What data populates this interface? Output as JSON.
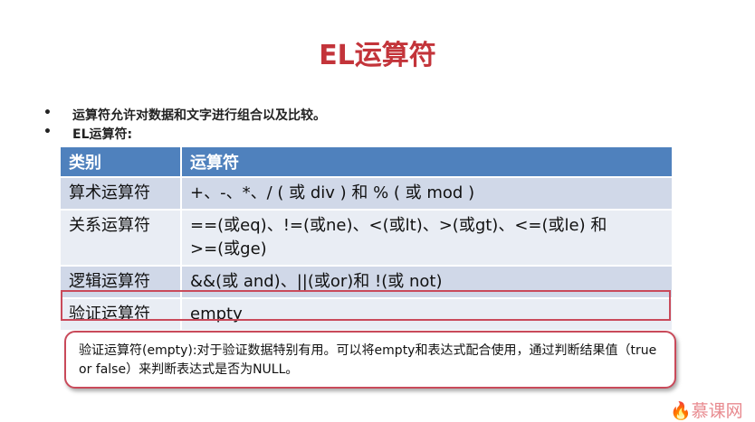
{
  "title": "EL运算符",
  "bullets": [
    "运算符允许对数据和文字进行组合以及比较。",
    "EL运算符:"
  ],
  "table": {
    "headers": [
      "类别",
      "运算符"
    ],
    "rows": [
      [
        "算术运算符",
        "+、-、*、/ ( 或 div ) 和 % ( 或 mod )"
      ],
      [
        "关系运算符",
        "==(或eq)、!=(或ne)、<(或lt)、>(或gt)、<=(或le)  和  >=(或ge)"
      ],
      [
        "逻辑运算符",
        "&&(或 and)、||(或or)和 !(或 not)"
      ],
      [
        "验证运算符",
        "empty"
      ]
    ]
  },
  "callout": "验证运算符(empty):对于验证数据特别有用。可以将empty和表达式配合使用，通过判断结果值（true or false）来判断表达式是否为NULL。",
  "logo": "慕课网",
  "colors": {
    "title": "#c3343a",
    "header": "#4f81bd",
    "highlight": "#c94a5a"
  }
}
